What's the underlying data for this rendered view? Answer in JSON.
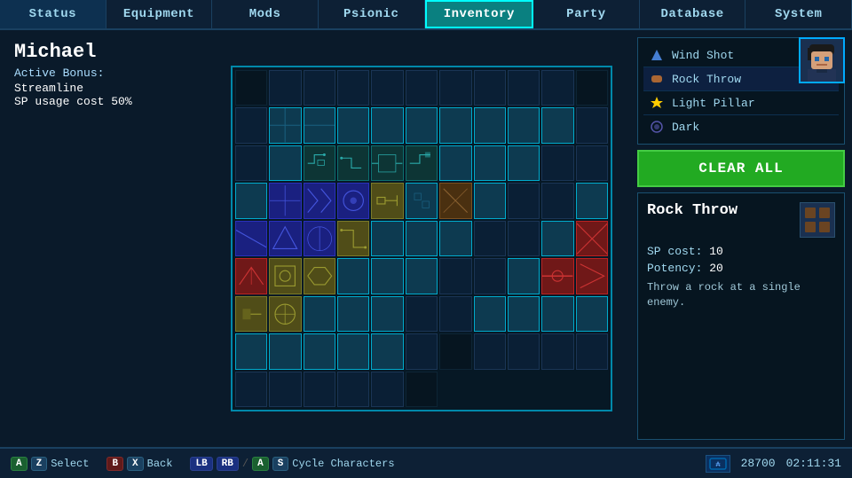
{
  "nav": {
    "tabs": [
      {
        "label": "Status",
        "active": false
      },
      {
        "label": "Equipment",
        "active": false
      },
      {
        "label": "Mods",
        "active": false
      },
      {
        "label": "Psionic",
        "active": true
      },
      {
        "label": "Inventory",
        "active": false
      },
      {
        "label": "Party",
        "active": false
      },
      {
        "label": "Database",
        "active": false
      },
      {
        "label": "System",
        "active": false
      }
    ]
  },
  "character": {
    "name": "Michael",
    "active_bonus_label": "Active Bonus:",
    "bonus_name": "Streamline",
    "bonus_desc": "SP usage cost 50%"
  },
  "skills": {
    "list": [
      {
        "name": "Wind Shot",
        "icon": "💠"
      },
      {
        "name": "Rock Throw",
        "icon": "🟫",
        "selected": true
      },
      {
        "name": "Light Pillar",
        "icon": "⭐"
      },
      {
        "name": "Dark",
        "icon": "🔵"
      }
    ],
    "clear_all": "CLEAR ALL"
  },
  "skill_detail": {
    "name": "Rock Throw",
    "sp_cost_label": "SP cost:",
    "sp_cost_value": "10",
    "potency_label": "Potency:",
    "potency_value": "20",
    "description": "Throw a rock at a single enemy."
  },
  "bottom_bar": {
    "controls": [
      {
        "buttons": [
          "A",
          "Z"
        ],
        "label": "Select"
      },
      {
        "buttons": [
          "B",
          "X"
        ],
        "label": "Back"
      },
      {
        "buttons": [
          "LB",
          "RB",
          "A",
          "S"
        ],
        "label": "Cycle Characters"
      }
    ],
    "gold": "28700",
    "time": "02:11:31"
  }
}
